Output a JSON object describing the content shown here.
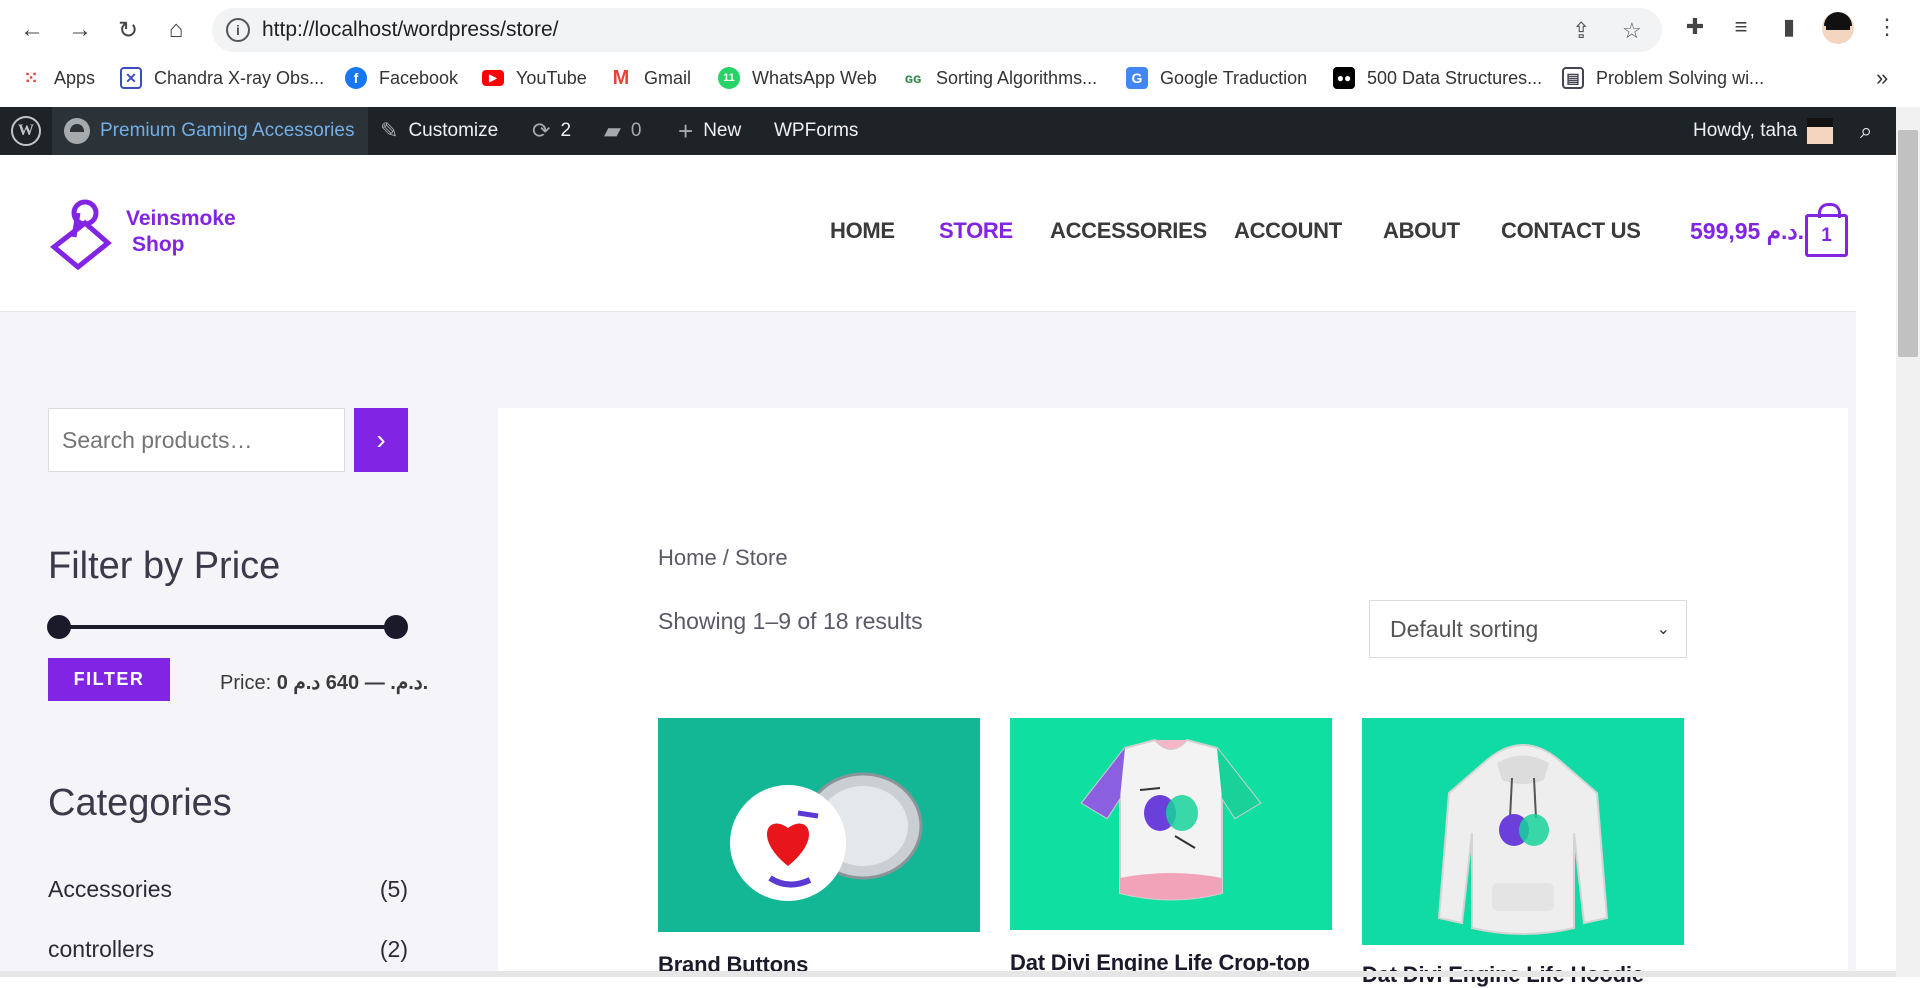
{
  "browser": {
    "url": "http://localhost/wordpress/store/",
    "bookmarks": [
      {
        "label": "Apps",
        "icon": "apps-grid-icon"
      },
      {
        "label": "Chandra X-ray Obs...",
        "icon": "chandra-icon"
      },
      {
        "label": "Facebook",
        "icon": "facebook-icon"
      },
      {
        "label": "YouTube",
        "icon": "youtube-icon"
      },
      {
        "label": "Gmail",
        "icon": "gmail-icon"
      },
      {
        "label": "WhatsApp Web",
        "icon": "whatsapp-icon"
      },
      {
        "label": "Sorting Algorithms...",
        "icon": "geeksforgeeks-icon"
      },
      {
        "label": "Google Traduction",
        "icon": "google-translate-icon"
      },
      {
        "label": "500 Data Structures...",
        "icon": "medium-icon"
      },
      {
        "label": "Problem Solving wi...",
        "icon": "doc-icon"
      }
    ],
    "bookmarks_more": "»",
    "whatsapp_badge": "11"
  },
  "admin_bar": {
    "site_name": "Premium Gaming Accessories",
    "customize": "Customize",
    "updates_count": "2",
    "comments_count": "0",
    "new": "New",
    "wpforms": "WPForms",
    "howdy": "Howdy, taha"
  },
  "site": {
    "logo_line1": "Veinsmoke",
    "logo_line2": "Shop",
    "menu": [
      "HOME",
      "STORE",
      "ACCESSORIES",
      "ACCOUNT",
      "ABOUT",
      "CONTACT US"
    ],
    "active_menu": "STORE",
    "cart_total": "599,95 د.م.",
    "cart_count": "1",
    "accent_color": "#8224e3"
  },
  "sidebar": {
    "search_placeholder": "Search products…",
    "filter_title": "Filter by Price",
    "filter_button": "FILTER",
    "price_prefix": "Price:",
    "price_range": "0 د.م. — 640 د.م.",
    "categories_title": "Categories",
    "categories": [
      {
        "name": "Accessories",
        "count": "(5)"
      },
      {
        "name": "controllers",
        "count": "(2)"
      }
    ]
  },
  "main": {
    "breadcrumb": "Home / Store",
    "result_count": "Showing 1–9 of 18 results",
    "sort_selected": "Default sorting",
    "products": [
      {
        "title": "Brand Buttons",
        "image_bg": "#14b795"
      },
      {
        "title": "Dat Divi Engine Life Crop-top",
        "image_bg": "#0fdfa0"
      },
      {
        "title": "Dat Divi Engine Life Hoodie",
        "image_bg": "#11dba5"
      }
    ]
  }
}
